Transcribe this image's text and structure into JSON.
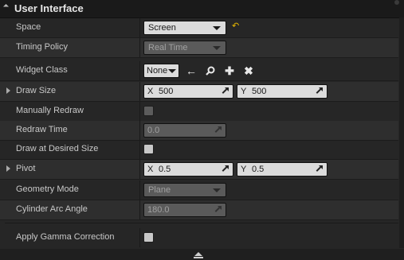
{
  "section": {
    "title": "User Interface"
  },
  "rows": {
    "space": {
      "label": "Space",
      "value": "Screen"
    },
    "timing_policy": {
      "label": "Timing Policy",
      "value": "Real Time"
    },
    "widget_class": {
      "label": "Widget Class",
      "value": "None"
    },
    "draw_size": {
      "label": "Draw Size",
      "x_axis": "X",
      "x": "500",
      "y_axis": "Y",
      "y": "500"
    },
    "manually_redraw": {
      "label": "Manually Redraw",
      "checked": false
    },
    "redraw_time": {
      "label": "Redraw Time",
      "value": "0.0"
    },
    "draw_at_desired_size": {
      "label": "Draw at Desired Size",
      "checked": false
    },
    "pivot": {
      "label": "Pivot",
      "x_axis": "X",
      "x": "0.5",
      "y_axis": "Y",
      "y": "0.5"
    },
    "geometry_mode": {
      "label": "Geometry Mode",
      "value": "Plane"
    },
    "cylinder_arc_angle": {
      "label": "Cylinder Arc Angle",
      "value": "180.0"
    },
    "apply_gamma_correction": {
      "label": "Apply Gamma Correction",
      "checked": false
    }
  },
  "icons": {
    "reset": "reset-to-default-icon",
    "browse_back": "arrow-left-icon",
    "browse": "search-icon",
    "add": "plus-icon",
    "clear": "close-icon"
  },
  "colors": {
    "background": "#262626",
    "header": "#1a1a1a",
    "field": "#dcdcdc",
    "reset": "#e8b800"
  }
}
